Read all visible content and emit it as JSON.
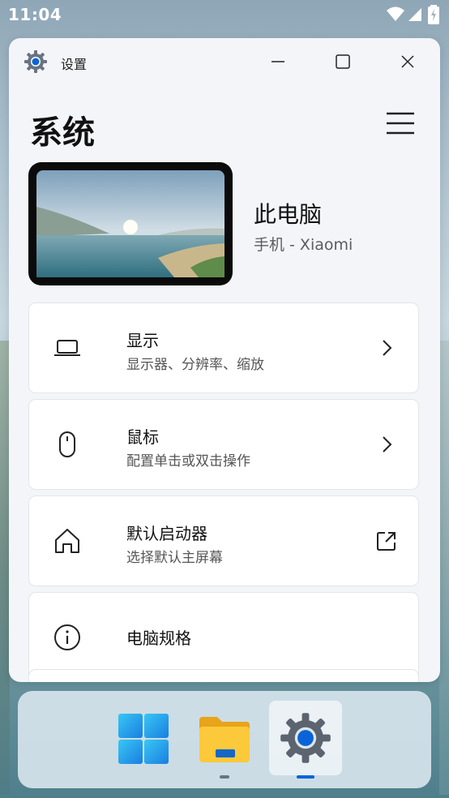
{
  "status_bar": {
    "time": "11:04",
    "icons": [
      "wifi-icon",
      "signal-icon",
      "battery-charging-icon"
    ]
  },
  "window": {
    "title": "设置",
    "app_icon": "gear-icon",
    "controls": [
      "minimize-icon",
      "maximize-icon",
      "close-icon"
    ]
  },
  "page": {
    "title": "系统",
    "menu_icon": "hamburger-menu-icon"
  },
  "device": {
    "name": "此电脑",
    "subtitle": "手机 - Xiaomi"
  },
  "settings": [
    {
      "icon": "laptop-icon",
      "title": "显示",
      "subtitle": "显示器、分辨率、缩放",
      "trail_icon": "chevron-right-icon"
    },
    {
      "icon": "mouse-icon",
      "title": "鼠标",
      "subtitle": "配置单击或双击操作",
      "trail_icon": "chevron-right-icon"
    },
    {
      "icon": "home-icon",
      "title": "默认启动器",
      "subtitle": "选择默认主屏幕",
      "trail_icon": "external-link-icon"
    },
    {
      "icon": "info-icon",
      "title": "电脑规格"
    }
  ],
  "taskbar": {
    "apps": [
      {
        "icon": "windows-logo-icon",
        "active": false
      },
      {
        "icon": "file-explorer-icon",
        "active": false,
        "running": true
      },
      {
        "icon": "settings-gear-icon",
        "active": true,
        "running": true
      }
    ]
  },
  "colors": {
    "accent": "#0a64d8",
    "window_bg": "#f3f5f9",
    "card_bg": "#ffffff"
  }
}
